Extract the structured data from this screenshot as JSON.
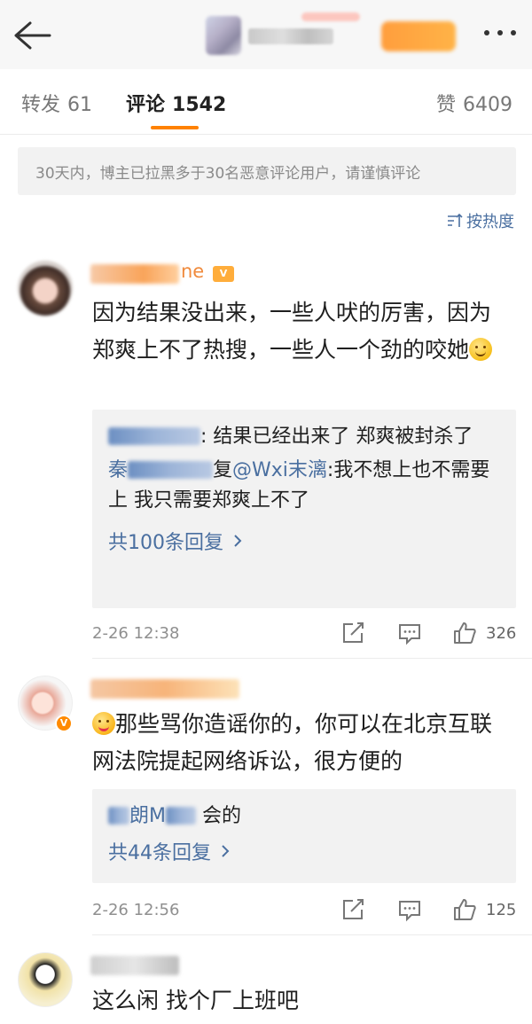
{
  "nav": {
    "back_icon": "arrow-left-icon",
    "more_icon": "ellipsis-icon"
  },
  "tabs": [
    {
      "label": "转发",
      "count": "61"
    },
    {
      "label": "评论",
      "count": "1542"
    },
    {
      "label": "赞",
      "count": "6409"
    }
  ],
  "notice": "30天内，博主已拉黑多于30名恶意评论用户，请谨慎评论",
  "sort": {
    "label": "按热度",
    "icon": "sort-icon"
  },
  "comments": [
    {
      "name_partial": "ne",
      "text": "因为结果没出来，一些人吠的厉害，因为郑爽上不了热搜，一些人一个劲的咬她",
      "replies": [
        {
          "name_partial": "",
          "text": "结果已经出来了 郑爽被封杀了"
        },
        {
          "name_partial": "秦",
          "prefix": "复",
          "mention": "@Wxi末漓",
          "text": ":我不想上也不需要上 我只需要郑爽上不了"
        }
      ],
      "more_replies": "共100条回复",
      "time": "2-26 12:38",
      "likes": "326"
    },
    {
      "name_partial": "",
      "text": "那些骂你造谣你的，你可以在北京互联网法院提起网络诉讼，很方便的",
      "replies": [
        {
          "name_partial": "朗M",
          "text": "会的"
        }
      ],
      "more_replies": "共44条回复",
      "time": "2-26 12:56",
      "likes": "125"
    },
    {
      "name_partial": "",
      "text": "这么闲 找个厂上班吧"
    }
  ]
}
